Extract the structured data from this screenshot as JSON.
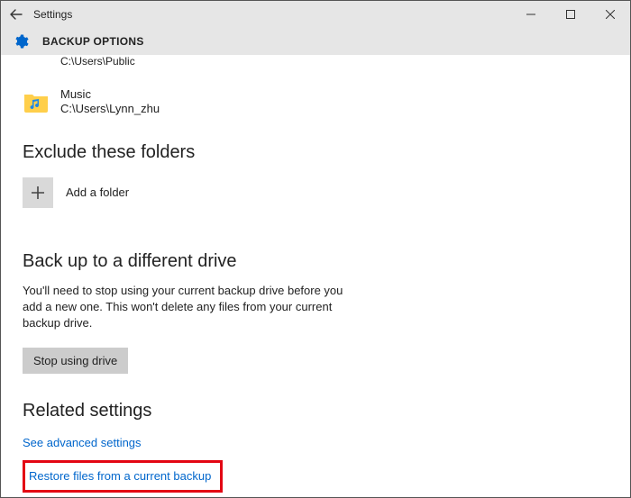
{
  "titlebar": {
    "title": "Settings"
  },
  "header": {
    "title": "BACKUP OPTIONS"
  },
  "truncated_path": "C:\\Users\\Public",
  "folder_item": {
    "name": "Music",
    "path": "C:\\Users\\Lynn_zhu"
  },
  "sections": {
    "exclude_heading": "Exclude these folders",
    "add_folder_label": "Add a folder",
    "backup_heading": "Back up to a different drive",
    "backup_desc": "You'll need to stop using your current backup drive before you add a new one. This won't delete any files from your current backup drive.",
    "stop_button": "Stop using drive",
    "related_heading": "Related settings",
    "link_advanced": "See advanced settings",
    "link_restore": "Restore files from a current backup"
  }
}
